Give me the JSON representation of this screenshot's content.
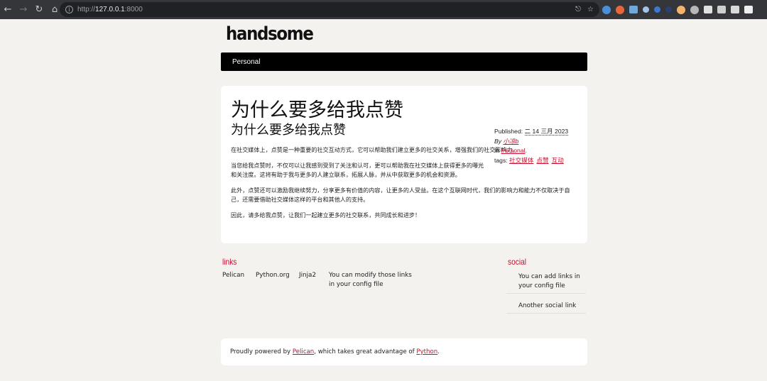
{
  "browser": {
    "url_scheme": "http://",
    "url_host": "127.0.0.1",
    "url_port": ":8000"
  },
  "site": {
    "logo": "handsome",
    "menu": [
      "Personal"
    ]
  },
  "article": {
    "title": "为什么要多给我点赞",
    "subtitle": "为什么要多给我点赞",
    "paragraphs": [
      "在社交媒体上，点赞是一种重要的社交互动方式，它可以帮助我们建立更多的社交关系，增强我们的社交影响力。",
      "当您给我点赞时，不仅可以让我感到受到了关注和认可，更可以帮助我在社交媒体上获得更多的曝光和关注度。这将有助于我与更多的人建立联系，拓展人脉，并从中获取更多的机会和资源。",
      "此外，点赞还可以激励我继续努力，分享更多有价值的内容，让更多的人受益。在这个互联网时代，我们的影响力和能力不仅取决于自己，还需要借助社交媒体这样的平台和其他人的支持。",
      "因此，请多给我点赞，让我们一起建立更多的社交联系，共同成长和进步！"
    ],
    "meta": {
      "published_label": "Published: ",
      "published_date": "二 14 三月 2023",
      "by_label": "By ",
      "author": "小凉b",
      "in_label": "In ",
      "category": "Personal",
      "category_suffix": ".",
      "tags_label": "tags: ",
      "tags": [
        "社交媒体",
        "点赞",
        "互动"
      ]
    }
  },
  "links": {
    "heading": "links",
    "items": [
      "Pelican",
      "Python.org",
      "Jinja2",
      "You can modify those links in your config file"
    ]
  },
  "social": {
    "heading": "social",
    "items": [
      "You can add links in your config file",
      "Another social link"
    ]
  },
  "footer": {
    "prefix": "Proudly powered by ",
    "pelican": "Pelican",
    "middle": ", which takes great advantage of ",
    "python": "Python",
    "suffix": "."
  }
}
